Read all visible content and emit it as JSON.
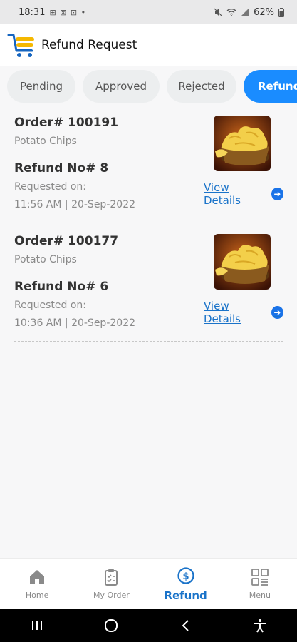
{
  "status_bar": {
    "time": "18:31",
    "left_icons": "⊞ ⊠ ⊡ •",
    "battery": "62%"
  },
  "header": {
    "title": "Refund Request"
  },
  "tabs": [
    {
      "label": "Pending"
    },
    {
      "label": "Approved"
    },
    {
      "label": "Rejected"
    },
    {
      "label": "Refund"
    }
  ],
  "orders": [
    {
      "order_number": "Order# 100191",
      "product": "Potato Chips",
      "refund_number": "Refund No# 8",
      "requested_label": "Requested on:",
      "requested_time": "11:56 AM | 20-Sep-2022",
      "view_details": "View Details"
    },
    {
      "order_number": "Order# 100177",
      "product": "Potato Chips",
      "refund_number": "Refund No# 6",
      "requested_label": "Requested on:",
      "requested_time": "10:36 AM | 20-Sep-2022",
      "view_details": "View Details"
    }
  ],
  "bottom_nav": [
    {
      "label": "Home",
      "icon": "home-icon"
    },
    {
      "label": "My Order",
      "icon": "clipboard-icon"
    },
    {
      "label": "Refund",
      "icon": "dollar-refund-icon",
      "active": true
    },
    {
      "label": "Menu",
      "icon": "grid-menu-icon"
    }
  ],
  "colors": {
    "accent": "#1a8cff",
    "link": "#1a73c9",
    "logo_blue": "#1565c0",
    "logo_yellow": "#f5b800"
  }
}
